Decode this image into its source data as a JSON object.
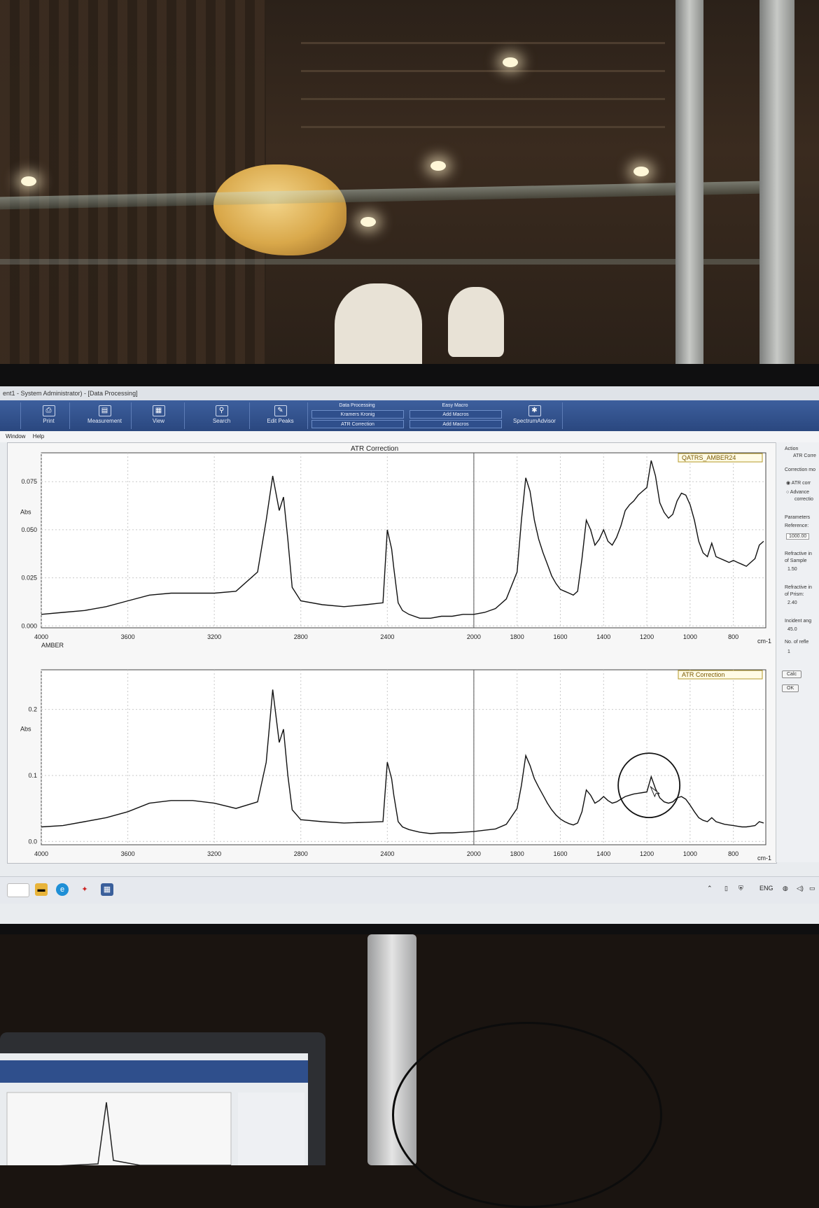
{
  "window": {
    "title": "ent1 - System Administrator) - [Data Processing]"
  },
  "ribbon": {
    "print_label": "Print",
    "measurement_label": "Measurement",
    "view_label": "View",
    "search_label": "Search",
    "edit_peaks_label": "Edit Peaks",
    "data_processing": {
      "header": "Data Processing",
      "item1": "Kramers Kronig",
      "item2": "ATR Correction"
    },
    "easy_macro": {
      "header": "Easy Macro",
      "item1": "Add Macros",
      "item2": "Add Macros"
    },
    "spectrum_advisor_label": "SpectrumAdvisor"
  },
  "menu": {
    "window": "Window",
    "help": "Help"
  },
  "side_panel": {
    "action_label": "Action",
    "action_value": "ATR Corre",
    "correction_mode_label": "Correction mo",
    "mode_atr": "ATR corr",
    "mode_advanced_1": "Advance",
    "mode_advanced_2": "correctio",
    "parameters_label": "Parameters",
    "reference_label": "Reference:",
    "reference_value": "1000.00",
    "ri_sample_label_1": "Refractive in",
    "ri_sample_label_2": "of Sample",
    "ri_sample_value": "1.50",
    "ri_prism_label_1": "Refractive in",
    "ri_prism_label_2": "of Prism:",
    "ri_prism_value": "2.40",
    "incident_angle_label": "Incident ang",
    "incident_angle_value": "45.0",
    "reflections_label": "No. of refle",
    "reflections_value": "1",
    "calc_button": "Calc",
    "ok_button": "OK"
  },
  "taskbar": {
    "language": "ENG"
  },
  "chart_data": [
    {
      "type": "line",
      "title": "ATR Correction",
      "legend": "QATRS_AMBER24",
      "legend_placement": "top-right",
      "ylabel": "Abs",
      "xlabel": "cm-1",
      "series_label_below": "AMBER",
      "xlim": [
        4000,
        650
      ],
      "ylim": [
        -0.001,
        0.09
      ],
      "x_ticks": [
        "4000",
        "3600",
        "3200",
        "2800",
        "2400",
        "2000",
        "1800",
        "1600",
        "1400",
        "1200",
        "1000",
        "800"
      ],
      "y_ticks": [
        "0.000",
        "0.025",
        "0.050",
        "0.075"
      ],
      "grid": true,
      "series": [
        {
          "x": [
            4000,
            3900,
            3800,
            3700,
            3600,
            3500,
            3400,
            3300,
            3200,
            3100,
            3000,
            2960,
            2930,
            2900,
            2880,
            2860,
            2840,
            2800,
            2700,
            2600,
            2500,
            2420,
            2400,
            2380,
            2370,
            2350,
            2330,
            2300,
            2250,
            2200,
            2150,
            2100,
            2050,
            2000,
            1950,
            1900,
            1850,
            1800,
            1780,
            1760,
            1740,
            1720,
            1700,
            1680,
            1660,
            1640,
            1620,
            1600,
            1580,
            1560,
            1540,
            1520,
            1500,
            1480,
            1460,
            1440,
            1420,
            1400,
            1380,
            1360,
            1340,
            1320,
            1300,
            1280,
            1260,
            1240,
            1220,
            1200,
            1180,
            1160,
            1140,
            1120,
            1100,
            1080,
            1060,
            1040,
            1020,
            1000,
            980,
            960,
            940,
            920,
            900,
            880,
            860,
            840,
            820,
            800,
            780,
            760,
            740,
            720,
            700,
            680,
            660
          ],
          "y": [
            0.006,
            0.007,
            0.008,
            0.01,
            0.013,
            0.016,
            0.017,
            0.017,
            0.017,
            0.018,
            0.028,
            0.055,
            0.078,
            0.06,
            0.067,
            0.045,
            0.02,
            0.013,
            0.011,
            0.01,
            0.011,
            0.012,
            0.05,
            0.04,
            0.03,
            0.012,
            0.008,
            0.006,
            0.004,
            0.004,
            0.005,
            0.005,
            0.006,
            0.006,
            0.007,
            0.009,
            0.014,
            0.028,
            0.055,
            0.077,
            0.07,
            0.055,
            0.045,
            0.038,
            0.032,
            0.026,
            0.022,
            0.019,
            0.018,
            0.017,
            0.016,
            0.018,
            0.035,
            0.055,
            0.05,
            0.042,
            0.045,
            0.05,
            0.044,
            0.042,
            0.046,
            0.052,
            0.06,
            0.063,
            0.065,
            0.068,
            0.07,
            0.072,
            0.086,
            0.078,
            0.064,
            0.059,
            0.056,
            0.058,
            0.065,
            0.069,
            0.068,
            0.063,
            0.055,
            0.044,
            0.038,
            0.036,
            0.043,
            0.036,
            0.035,
            0.034,
            0.033,
            0.034,
            0.033,
            0.032,
            0.031,
            0.033,
            0.035,
            0.042,
            0.044
          ]
        }
      ]
    },
    {
      "type": "line",
      "legend": "ATR Correction",
      "legend_placement": "top-right",
      "ylabel": "Abs",
      "xlabel": "cm-1",
      "xlim": [
        4000,
        650
      ],
      "ylim": [
        -0.005,
        0.26
      ],
      "x_ticks": [
        "4000",
        "3600",
        "3200",
        "2800",
        "2400",
        "2000",
        "1800",
        "1600",
        "1400",
        "1200",
        "1000",
        "800"
      ],
      "y_ticks": [
        "0.0",
        "0.1",
        "0.2"
      ],
      "grid": true,
      "series": [
        {
          "x": [
            4000,
            3900,
            3800,
            3700,
            3600,
            3500,
            3400,
            3300,
            3200,
            3100,
            3000,
            2960,
            2930,
            2900,
            2880,
            2860,
            2840,
            2800,
            2700,
            2600,
            2500,
            2420,
            2400,
            2380,
            2370,
            2350,
            2330,
            2300,
            2250,
            2200,
            2150,
            2100,
            2050,
            2000,
            1950,
            1900,
            1850,
            1800,
            1780,
            1760,
            1740,
            1720,
            1700,
            1680,
            1660,
            1640,
            1620,
            1600,
            1580,
            1560,
            1540,
            1520,
            1500,
            1480,
            1460,
            1440,
            1420,
            1400,
            1380,
            1360,
            1340,
            1320,
            1300,
            1280,
            1260,
            1240,
            1220,
            1200,
            1180,
            1160,
            1140,
            1120,
            1100,
            1080,
            1060,
            1040,
            1020,
            1000,
            980,
            960,
            940,
            920,
            900,
            880,
            860,
            840,
            820,
            800,
            780,
            760,
            740,
            720,
            700,
            680,
            660
          ],
          "y": [
            0.022,
            0.024,
            0.03,
            0.036,
            0.045,
            0.058,
            0.062,
            0.062,
            0.058,
            0.05,
            0.06,
            0.12,
            0.23,
            0.15,
            0.17,
            0.1,
            0.048,
            0.033,
            0.03,
            0.028,
            0.029,
            0.03,
            0.12,
            0.095,
            0.07,
            0.03,
            0.022,
            0.018,
            0.014,
            0.012,
            0.013,
            0.013,
            0.014,
            0.015,
            0.017,
            0.019,
            0.026,
            0.05,
            0.085,
            0.13,
            0.115,
            0.095,
            0.082,
            0.07,
            0.058,
            0.048,
            0.04,
            0.034,
            0.03,
            0.027,
            0.025,
            0.028,
            0.045,
            0.078,
            0.07,
            0.058,
            0.062,
            0.068,
            0.062,
            0.058,
            0.06,
            0.064,
            0.068,
            0.07,
            0.072,
            0.073,
            0.074,
            0.075,
            0.098,
            0.08,
            0.066,
            0.06,
            0.058,
            0.06,
            0.066,
            0.068,
            0.064,
            0.055,
            0.045,
            0.036,
            0.032,
            0.03,
            0.036,
            0.03,
            0.028,
            0.026,
            0.025,
            0.024,
            0.023,
            0.022,
            0.022,
            0.023,
            0.024,
            0.03,
            0.028
          ]
        }
      ]
    }
  ]
}
